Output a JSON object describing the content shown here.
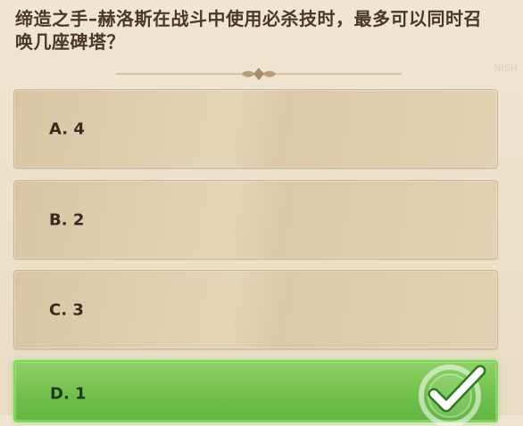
{
  "question": {
    "text": "缔造之手–赫洛斯在战斗中使用必杀技时，最多可以同时召唤几座碑塔？"
  },
  "background": {
    "ghost_text": "NISH"
  },
  "options": [
    {
      "label": "A. 4",
      "correct": false
    },
    {
      "label": "B. 2",
      "correct": false
    },
    {
      "label": "C. 3",
      "correct": false
    },
    {
      "label": "D. 1",
      "correct": true
    }
  ],
  "colors": {
    "text": "#4a3826",
    "option_bg": "#e0cfb2",
    "correct_bg": "#72c04d",
    "check": "#ffffff"
  },
  "icons": {
    "divider": "ornament-divider-icon",
    "correct": "checkmark-icon"
  }
}
